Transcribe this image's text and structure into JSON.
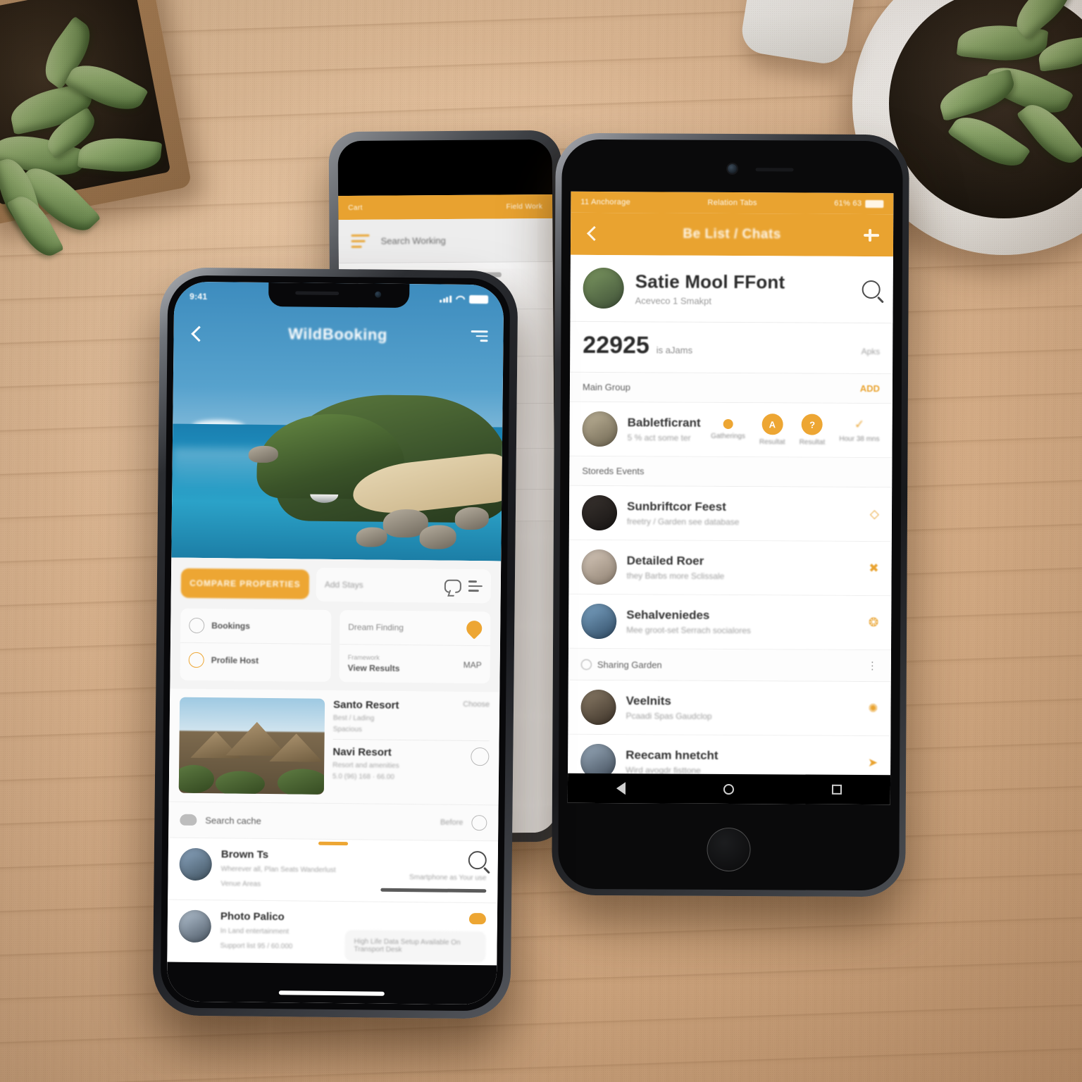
{
  "scene": {
    "description": "Two smartphones on a light wooden desk with succulent plants",
    "desk_color": "#d8b08a",
    "objects": [
      "square-planter-succulent",
      "round-white-pot-succulent",
      "white-mug"
    ]
  },
  "left_phone": {
    "device": "Notched smartphone, front, portrait",
    "status_bar": {
      "time": "9:41",
      "icons": [
        "signal-bars",
        "wifi",
        "battery"
      ]
    },
    "nav": {
      "back_icon": "chevron-left-icon",
      "title": "WildBooking",
      "filter_icon": "filter-icon"
    },
    "hero": {
      "alt": "Tropical bay with turquoise water, rocky headland and beach"
    },
    "search_row": {
      "primary_button": "COMPARE PROPERTIES",
      "search_placeholder": "Add Stays",
      "chat_icon": "chat-bubble-icon",
      "sliders_icon": "sliders-icon"
    },
    "quick_cards": [
      {
        "icon": "clock-icon",
        "label": "Bookings"
      },
      {
        "icon": "person-icon",
        "label": "Profile Host"
      },
      {
        "label": "Dream Finding",
        "icon": "location-pin-icon"
      },
      {
        "overline": "Framework",
        "label": "View Results",
        "value": "MAP"
      }
    ],
    "listing": {
      "image_alt": "Thatched-roof villa resort above the ocean",
      "title": "Santo Resort",
      "price_label": "Choose",
      "meta_line1": "Best / Lading",
      "meta_line2": "Spacious",
      "secondary_title": "Navi Resort",
      "secondary_line1": "Resort and amenities",
      "secondary_line2": "5.0 (96) 168 · 66.00",
      "secondary_icon": "refresh-icon"
    },
    "wide_row": {
      "icon": "cloud-icon",
      "label": "Search cache",
      "value": "Before",
      "trailing_icon": "cloud-icon"
    },
    "contacts": [
      {
        "name": "Brown Ts",
        "line1": "Wherever all, Plan Seats Wanderlust",
        "line2": "Venue Areas",
        "right_icon": "search-icon",
        "right_text": "Smartphone as Your use",
        "progress": 74
      },
      {
        "name": "Photo Palico",
        "line1": "In Land entertainment",
        "line2": "Support list 95 / 60.000",
        "right_icon": "cloud-icon",
        "field_placeholder": "High Life Data Setup Available On Transport Desk"
      }
    ]
  },
  "middle_phone": {
    "device": "Smartphone, behind",
    "top_bar": {
      "left": "Cart",
      "right": "Field Work"
    },
    "search": {
      "menu_icon": "hamburger-icon",
      "placeholder": "Search Working"
    },
    "rows": [
      {
        "thumb": "photo-1"
      },
      {
        "thumb": "photo-2"
      },
      {
        "thumb": "photo-3"
      }
    ]
  },
  "right_phone": {
    "device": "White-framed smartphone with physical home button, Android",
    "status_bar": {
      "left": "11 Anchorage",
      "center": "Relation Tabs",
      "right": "61% 63"
    },
    "app_bar": {
      "back_icon": "chevron-left-icon",
      "title": "Be List / Chats",
      "add_icon": "plus-icon"
    },
    "profile": {
      "avatar": "avatar-portrait",
      "name": "Satie Mool FFont",
      "subtitle": "Aceveco 1 Smakpt",
      "search_icon": "search-icon"
    },
    "stat": {
      "value": "22925",
      "unit": "is aJams",
      "right": "Apks"
    },
    "sections": [
      {
        "label": "Main Group",
        "action": "ADD"
      },
      {
        "label": "Storeds Events"
      },
      {
        "icon": "clock-icon",
        "label": "Sharing Garden",
        "action_icon": "kebab-menu-icon"
      }
    ],
    "highlight_row": {
      "avatar": "avatar-field",
      "title": "Babletficrant",
      "subtitle": "5 % act some ter",
      "chips": [
        {
          "badge": "",
          "label": "Gatherings",
          "small": true
        },
        {
          "badge": "A",
          "label": "Resultat"
        },
        {
          "badge": "?",
          "label": "Resultat"
        },
        {
          "badge": "",
          "label": "Hour 38 mns",
          "check": true
        }
      ]
    },
    "list_items": [
      {
        "avatar": "avatar-1",
        "title": "Sunbriftcor Feest",
        "subtitle": "freetry / Garden see database",
        "trail_icon": "tag-icon"
      },
      {
        "avatar": "avatar-2",
        "title": "Detailed Roer",
        "subtitle": "they Barbs more Sclissale",
        "trail_icon": "scissors-icon"
      },
      {
        "avatar": "avatar-3",
        "title": "Sehalveniedes",
        "subtitle": "Mee groot-set Serrach socialores",
        "trail_icon": "ribbon-icon"
      },
      {
        "avatar": "avatar-4",
        "title": "Veelnits",
        "subtitle": "Pcaadi Spas Gaudclop",
        "trail_icon": "sparkle-icon"
      },
      {
        "avatar": "avatar-5",
        "title": "Reecam hnetcht",
        "subtitle": "Wird avogdr fisttone",
        "trail_icon": "arrow-icon"
      }
    ],
    "nav_bar": {
      "back": "nav-back-triangle",
      "home": "nav-home-circle",
      "recents": "nav-recents-square"
    }
  },
  "colors": {
    "orange": "#e9a330",
    "blue": "#3d8cbe",
    "desk": "#d8b08a",
    "card": "#fbfbfb"
  }
}
